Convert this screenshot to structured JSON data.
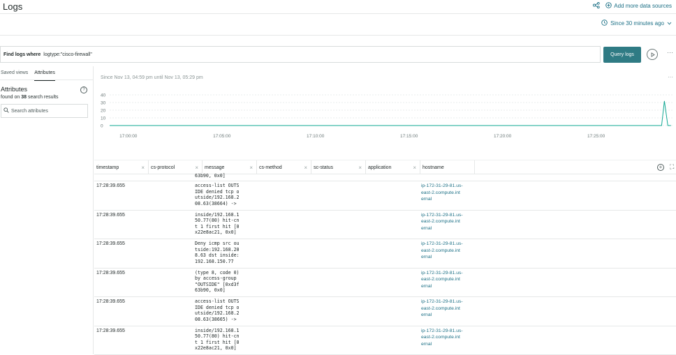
{
  "header": {
    "title": "Logs",
    "add_sources_label": "Add more data sources",
    "time_picker_label": "Since 30 minutes ago"
  },
  "query": {
    "prefix_label": "Find logs where",
    "value": "logtype:\"cisco-firewall\"",
    "run_label": "Query logs"
  },
  "sidebar": {
    "tabs": [
      "Saved views",
      "Attributes"
    ],
    "active_tab": "Attributes",
    "attributes_title": "Attributes",
    "found_prefix": "found on",
    "found_count": "38",
    "found_suffix": "search results",
    "search_placeholder": "Search attributes"
  },
  "chart_data": {
    "type": "line",
    "title": "Since Nov 13, 04:59 pm until Nov 13, 05:29 pm",
    "xlabel": "",
    "ylabel": "",
    "y_ticks": [
      "40",
      "30",
      "20",
      "10",
      "0"
    ],
    "ylim": [
      0,
      40
    ],
    "x_ticks": [
      "17:00:00",
      "17:05:00",
      "17:10:00",
      "17:15:00",
      "17:20:00",
      "17:25:00"
    ],
    "grid": true,
    "series": [
      {
        "color": "#11a893",
        "x": [
          "16:59",
          "17:00",
          "17:05",
          "17:10",
          "17:15",
          "17:20",
          "17:25",
          "17:28",
          "17:28:30",
          "17:28:39",
          "17:28:50",
          "17:29"
        ],
        "values": [
          0,
          0,
          0,
          0,
          0,
          0,
          0,
          0,
          0,
          32,
          0,
          0
        ]
      }
    ],
    "colors": {
      "line": "#11a893",
      "grid": "#e3e6e6",
      "axis": "#c8cdcd"
    }
  },
  "table": {
    "columns": [
      "timestamp",
      "cs-protocol",
      "message",
      "cs-method",
      "sc-status",
      "application",
      "hostname"
    ],
    "partial_message": "63b90, 0x0]",
    "rows": [
      {
        "timestamp": "17:28:39.655",
        "message": "access-list OUTS\nIDE denied tcp o\nutside/192.168.2\n08.63(38664) ->",
        "hostname": "ip-172-31-29-81.us-\neast-2.compute.int\nernal"
      },
      {
        "timestamp": "17:28:39.655",
        "message": "inside/192.168.1\n50.77(80) hit-cn\nt 1 first hit [0\nx22e8ac21, 0x0]",
        "hostname": "ip-172-31-29-81.us-\neast-2.compute.int\nernal"
      },
      {
        "timestamp": "17:28:39.655",
        "message": "Deny icmp src ou\ntside:192.168.20\n8.63 dst inside:\n192.168.150.77",
        "hostname": "ip-172-31-29-81.us-\neast-2.compute.int\nernal"
      },
      {
        "timestamp": "17:28:39.655",
        "message": "(type 8, code 0)\nby access-group\n\"OUTSIDE\" [0xd3f\n63b90, 0x0]",
        "hostname": "ip-172-31-29-81.us-\neast-2.compute.int\nernal"
      },
      {
        "timestamp": "17:28:39.655",
        "message": "access-list OUTS\nIDE denied tcp o\nutside/192.168.2\n08.63(38665) ->",
        "hostname": "ip-172-31-29-81.us-\neast-2.compute.int\nernal"
      },
      {
        "timestamp": "17:28:39.655",
        "message": "inside/192.168.1\n50.77(80) hit-cn\nt 1 first hit [0\nx22e8ac21, 0x0]",
        "hostname": "ip-172-31-29-81.us-\neast-2.compute.int\nernal"
      }
    ]
  }
}
